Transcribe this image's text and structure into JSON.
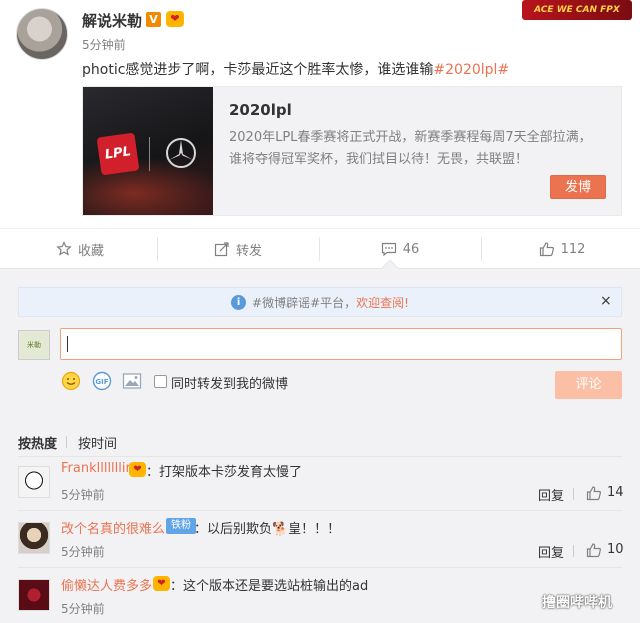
{
  "post": {
    "author": "解说米勒",
    "verified_badge": "V",
    "time": "5分钟前",
    "text_plain": "photic感觉进步了啊，卡莎最近这个胜率太惨，谁选谁输",
    "hashtag": "#2020lpl#",
    "corner_logo_text": "ACE WE CAN FPX"
  },
  "card": {
    "thumb_logo": "LPL",
    "title": "2020lpl",
    "description": "2020年LPL春季赛将正式开战，新赛季赛程每周7天全部拉满，谁将夺得冠军奖杯，我们拭目以待！无畏，共联盟！",
    "button": "发博"
  },
  "actions": {
    "favorite": "收藏",
    "repost": "转发",
    "comments": "46",
    "likes": "112"
  },
  "notice": {
    "text": "#微博辟谣#平台，",
    "link": "欢迎查阅!",
    "close": "×"
  },
  "composer": {
    "avatar_text": "米勒",
    "input_value": "",
    "checkbox_label": "同时转发到我的微博",
    "submit": "评论",
    "icons": [
      "smiley-icon",
      "gif-icon",
      "image-icon"
    ]
  },
  "sort": {
    "hot": "按热度",
    "time": "按时间"
  },
  "comments": [
    {
      "name": "Franklllllllin",
      "text": "：打架版本卡莎发育太慢了",
      "time": "5分钟前",
      "reply": "回复",
      "likes": "14"
    },
    {
      "name": "改个名真的很难么",
      "fan_badge": "铁粉",
      "text": "：以后别欺负🐕皇！！！",
      "time": "5分钟前",
      "reply": "回复",
      "likes": "10"
    },
    {
      "name": "偷懒达人费多多",
      "text": "：这个版本还是要选站桩输出的ad",
      "time": "5分钟前"
    }
  ],
  "watermark": "撸圈哔哔机",
  "colors": {
    "accent": "#eb7350",
    "muted": "#808080",
    "bg_gray": "#f2f2f5"
  }
}
